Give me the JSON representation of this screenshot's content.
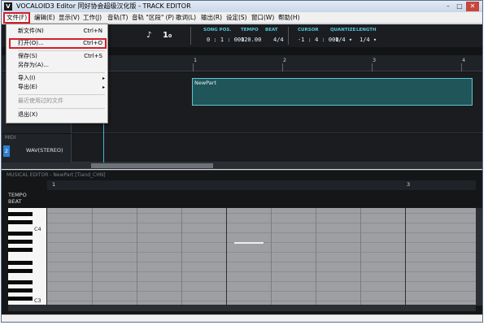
{
  "window": {
    "title": "VOCALOID3 Editor 同好协会超级汉化版 - TRACK EDITOR",
    "icon_text": "V"
  },
  "menubar": {
    "items": [
      {
        "label": "文件(F)"
      },
      {
        "label": "编辑(E)"
      },
      {
        "label": "显示(V)"
      },
      {
        "label": "工作(J)"
      },
      {
        "label": "音轨(T)"
      },
      {
        "label": "音轨 \"区段\" (P)"
      },
      {
        "label": "歌词(L)"
      },
      {
        "label": "输出(R)"
      },
      {
        "label": "设定(S)"
      },
      {
        "label": "窗口(W)"
      },
      {
        "label": "帮助(H)"
      }
    ]
  },
  "toolbar": {
    "song_pos": {
      "label": "SONG POS.",
      "value": "0 : 1 : 000"
    },
    "tempo": {
      "label": "TEMPO",
      "value": "120.00"
    },
    "beat": {
      "label": "BEAT",
      "value": "4/4"
    },
    "cursor": {
      "label": "CURSOR",
      "value": "-1 : 4 : 000"
    },
    "quantize": {
      "label": "QUANTIZE",
      "value": "1/4 ▾"
    },
    "length": {
      "label": "LENGTH",
      "value": "1/4 ▾"
    },
    "icons": [
      "note-tool-icon",
      "line-tool-icon"
    ],
    "icon_glyphs": [
      "♪",
      "1₀"
    ]
  },
  "track_editor": {
    "ruler_numbers": [
      "1",
      "2",
      "3",
      "4"
    ],
    "part_name": "NewPart",
    "wav_track_label": "WAV(STEREO)",
    "midi_label": "MIDI",
    "track_number": "2"
  },
  "musical_editor": {
    "title": "MUSICAL EDITOR - NewPart [Tiand_CHN]",
    "ruler_numbers": [
      "1",
      "3"
    ],
    "tempo_label": "TEMPO",
    "beat_label": "BEAT",
    "key_c4": "C4",
    "key_c3": "C3"
  },
  "file_menu": {
    "items": [
      {
        "label": "新文件(N)",
        "shortcut": "Ctrl+N"
      },
      {
        "label": "打开(O)...",
        "shortcut": "Ctrl+O"
      },
      {
        "label": "保存(S)",
        "shortcut": "Ctrl+S"
      },
      {
        "label": "另存为(A)...",
        "shortcut": ""
      },
      {
        "label": "导入(I)",
        "shortcut": "▸"
      },
      {
        "label": "导出(E)",
        "shortcut": "▸"
      },
      {
        "label": "最近使用过的文件",
        "shortcut": ""
      },
      {
        "label": "退出(X)",
        "shortcut": ""
      }
    ]
  },
  "colors": {
    "highlight": "#d21f2b",
    "accent": "#56c6d9",
    "part_fill": "#205559"
  }
}
